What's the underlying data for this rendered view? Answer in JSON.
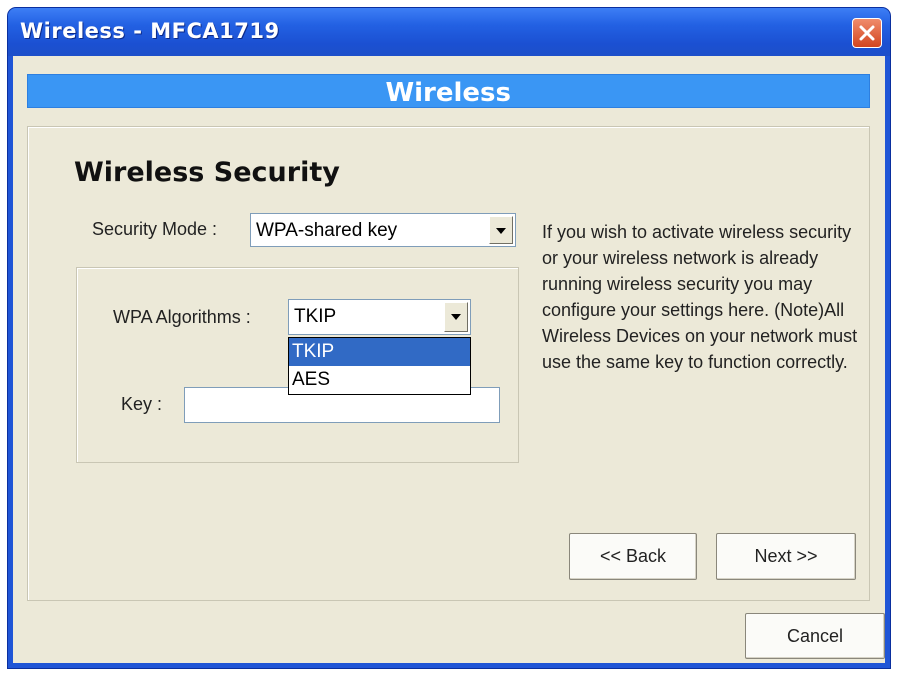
{
  "window": {
    "title": "Wireless - MFCA1719",
    "close_icon": "close-icon"
  },
  "banner": {
    "title": "Wireless"
  },
  "section": {
    "title": "Wireless Security"
  },
  "security_mode": {
    "label": "Security Mode :",
    "selected": "WPA-shared key"
  },
  "wpa_algorithms": {
    "label": "WPA Algorithms :",
    "selected": "TKIP",
    "options": [
      "TKIP",
      "AES"
    ],
    "highlighted": "TKIP"
  },
  "key": {
    "label": "Key :",
    "value": ""
  },
  "help_text": "If you wish to activate wireless security or your wireless network is already running wireless security you may configure your settings here. (Note)All Wireless Devices on your network must use the same key to function correctly.",
  "buttons": {
    "back": "<< Back",
    "next": "Next >>",
    "cancel": "Cancel"
  },
  "colors": {
    "titlebar": "#2361e3",
    "banner": "#3a96f4",
    "selection": "#316ac5",
    "dialog_bg": "#ece9d8"
  }
}
